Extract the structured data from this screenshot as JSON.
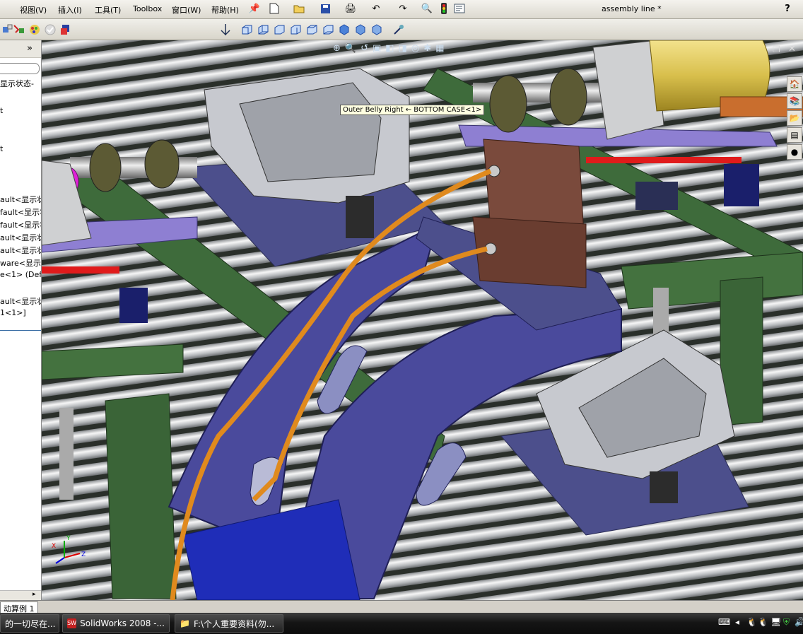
{
  "menubar": {
    "items": [
      "视图(V)",
      "插入(I)",
      "工具(T)",
      "Toolbox",
      "窗口(W)",
      "帮助(H)"
    ],
    "document_title": "assembly line *",
    "help_glyph": "?"
  },
  "feature_tree": {
    "collapse_glyph": "»",
    "items": [
      "显示状态-",
      "t",
      "t",
      "ault<显示状",
      "fault<显示状",
      "fault<显示状",
      "ault<显示状",
      "ault<显示状",
      "ware<显示",
      "e<1> (Defau",
      "ault<显示状",
      "1<1>]"
    ]
  },
  "viewport": {
    "tooltip": "Outer Belly Right ← BOTTOM CASE<1>",
    "axis_labels": {
      "x": "X",
      "y": "Y",
      "z": "Z"
    }
  },
  "tabs": {
    "active": "动算例 1"
  },
  "taskbar": {
    "items": [
      "的一切尽在...",
      "SolidWorks 2008 -...",
      "F:\\个人重要资料(勿..."
    ]
  },
  "colors": {
    "conveyor_frame": "#3e6b3b",
    "bracket": "#4a4a9c",
    "hose": "#e08a1e",
    "cylinder": "#7a4a3c",
    "plate": "#6f72b8",
    "motor": "#d9c35a"
  }
}
